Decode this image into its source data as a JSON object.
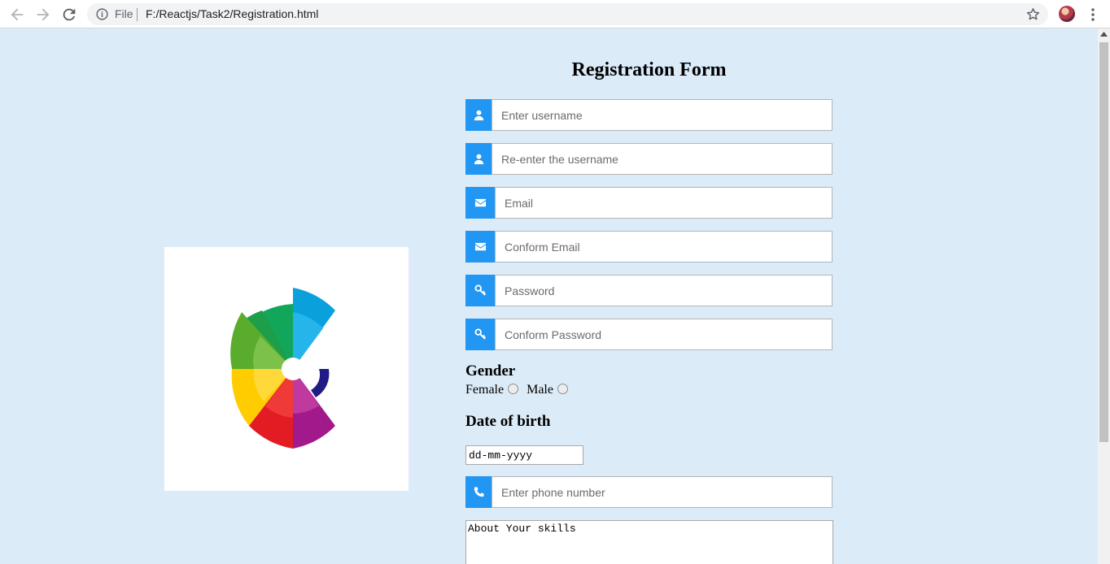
{
  "browser": {
    "scheme_label": "File",
    "url": "F:/Reactjs/Task2/Registration.html"
  },
  "form": {
    "title": "Registration Form",
    "fields": {
      "username": {
        "placeholder": "Enter username",
        "icon": "user-icon"
      },
      "reenter_username": {
        "placeholder": "Re-enter the username",
        "icon": "user-icon"
      },
      "email": {
        "placeholder": "Email",
        "icon": "envelope-icon"
      },
      "confirm_email": {
        "placeholder": "Conform Email",
        "icon": "envelope-icon"
      },
      "password": {
        "placeholder": "Password",
        "icon": "key-icon"
      },
      "confirm_password": {
        "placeholder": "Conform Password",
        "icon": "key-icon"
      },
      "phone": {
        "placeholder": "Enter phone number",
        "icon": "phone-icon"
      }
    },
    "gender": {
      "label": "Gender",
      "options": [
        "Female",
        "Male"
      ]
    },
    "dob": {
      "label": "Date of birth",
      "value": "dd-mm-yyyy"
    },
    "skills": {
      "value": "About Your skills"
    }
  },
  "colors": {
    "page_background": "#dbebf8",
    "accent": "#2196f3"
  }
}
